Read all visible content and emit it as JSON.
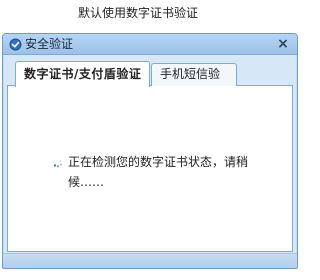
{
  "page": {
    "caption": "默认使用数字证书验证"
  },
  "dialog": {
    "title": "安全验证",
    "close_label": "×",
    "tabs": [
      {
        "label": "数字证书/支付盾验证",
        "active": true
      },
      {
        "label": "手机短信验证",
        "active": false
      }
    ],
    "status_text": "正在检测您的数字证书状态，请稍候……"
  },
  "icons": {
    "title_icon": "security-shield-icon",
    "spinner_icon": "loading-spinner-icon"
  },
  "colors": {
    "accent": "#6e9ec8",
    "dialog_bg": "#d6e7f7",
    "titlebar_top": "#b7d4f1",
    "titlebar_bottom": "#9cc1e8"
  }
}
